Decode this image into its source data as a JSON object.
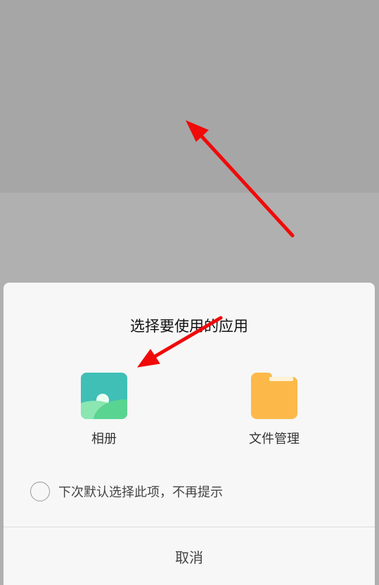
{
  "dialog": {
    "title": "选择要使用的应用",
    "apps": [
      {
        "label": "相册",
        "icon": "gallery-icon"
      },
      {
        "label": "文件管理",
        "icon": "folder-icon"
      }
    ],
    "remember_text": "下次默认选择此项，不再提示",
    "cancel_label": "取消"
  },
  "annotations": {
    "arrow_color": "#f00a0a"
  }
}
